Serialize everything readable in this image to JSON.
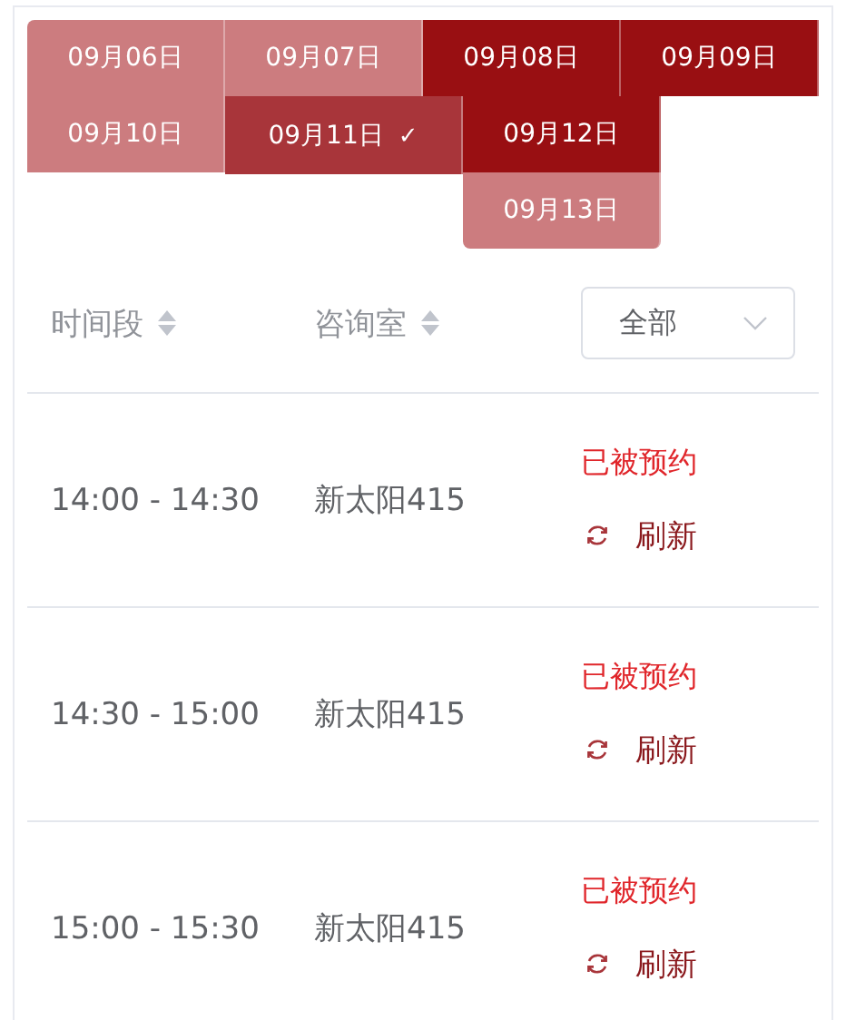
{
  "dates": [
    {
      "label": "09月06日",
      "color": "#cc7c7f",
      "selected": false
    },
    {
      "label": "09月07日",
      "color": "#cc7c7f",
      "selected": false
    },
    {
      "label": "09月08日",
      "color": "#990f12",
      "selected": false
    },
    {
      "label": "09月09日",
      "color": "#990f12",
      "selected": false
    },
    {
      "label": "09月10日",
      "color": "#cc7c7f",
      "selected": false
    },
    {
      "label": "09月11日",
      "color": "#a8353a",
      "selected": true,
      "check": "✓"
    },
    {
      "label": "09月12日",
      "color": "#990f12",
      "selected": false
    },
    {
      "label": "09月13日",
      "color": "#cc7c7f",
      "selected": false
    }
  ],
  "table": {
    "columns": [
      {
        "label": "时间段",
        "sortable": true
      },
      {
        "label": "咨询室",
        "sortable": true
      }
    ],
    "filter": {
      "value": "全部"
    },
    "rows": [
      {
        "time": "14:00 - 14:30",
        "room": "新太阳415",
        "status": "已被预约",
        "action": "刷新"
      },
      {
        "time": "14:30 - 15:00",
        "room": "新太阳415",
        "status": "已被预约",
        "action": "刷新"
      },
      {
        "time": "15:00 - 15:30",
        "room": "新太阳415",
        "status": "已被预约",
        "action": "刷新"
      }
    ]
  }
}
